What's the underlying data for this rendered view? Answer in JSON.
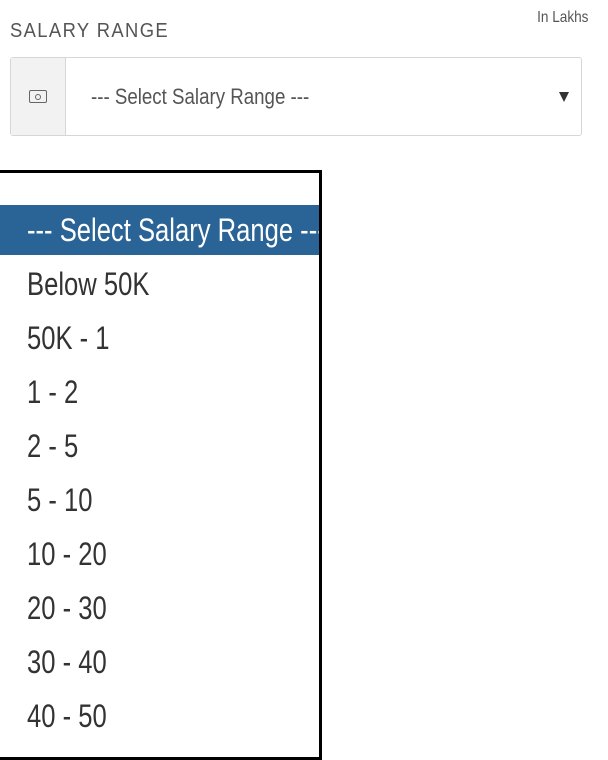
{
  "field": {
    "label": "SALARY RANGE",
    "unit_note": "In Lakhs",
    "addon_icon": "money-icon",
    "selected_value": "--- Select Salary Range ---"
  },
  "dropdown": {
    "options": [
      {
        "label": "--- Select Salary Range ---",
        "selected": true
      },
      {
        "label": "Below 50K",
        "selected": false
      },
      {
        "label": "50K - 1",
        "selected": false
      },
      {
        "label": "1 - 2",
        "selected": false
      },
      {
        "label": "2 - 5",
        "selected": false
      },
      {
        "label": "5 - 10",
        "selected": false
      },
      {
        "label": "10 - 20",
        "selected": false
      },
      {
        "label": "20 - 30",
        "selected": false
      },
      {
        "label": "30 - 40",
        "selected": false
      },
      {
        "label": "40 - 50",
        "selected": false
      }
    ],
    "highlight_color": "#2a6496"
  }
}
